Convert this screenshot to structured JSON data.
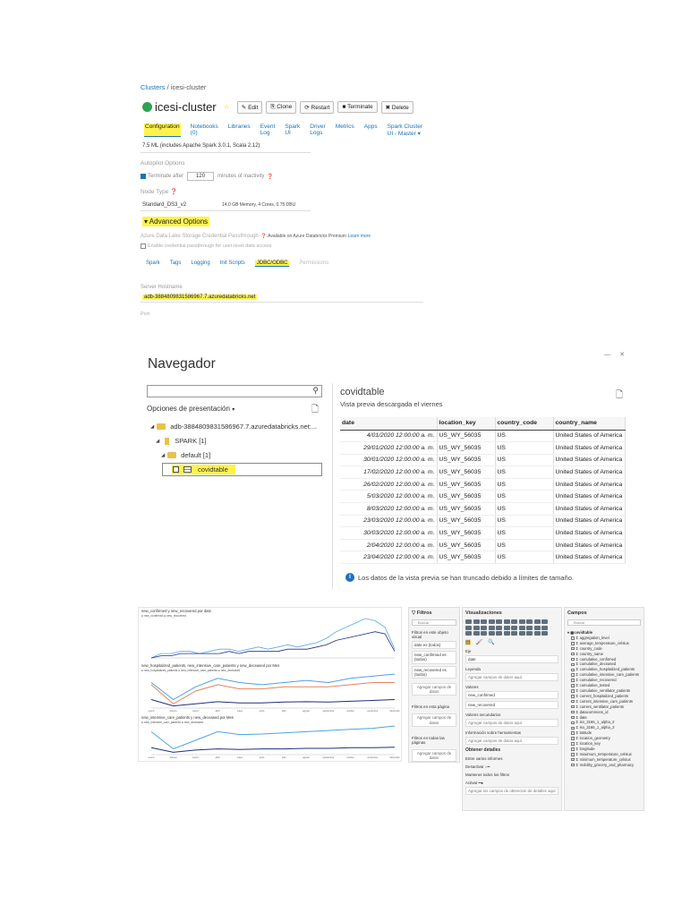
{
  "databricks": {
    "breadcrumb": {
      "clusters": "Clusters",
      "sep": " / ",
      "current": "icesi-cluster"
    },
    "cluster_name": "icesi-cluster",
    "buttons": {
      "edit": "Edit",
      "clone": "Clone",
      "restart": "Restart",
      "terminate": "Terminate",
      "delete": "Delete"
    },
    "tabs": [
      "Configuration",
      "Notebooks (0)",
      "Libraries",
      "Event Log",
      "Spark UI",
      "Driver Logs",
      "Metrics",
      "Apps",
      "Spark Cluster UI - Master ▾"
    ],
    "runtime": "7.5 ML (includes Apache Spark 3.0.1, Scala 2.12)",
    "autopilot_label": "Autopilot Options",
    "terminate_after": "Terminate after",
    "terminate_minutes": "120",
    "inactivity": "minutes of inactivity",
    "node_type_label": "Node Type",
    "node_type": "Standard_DS3_v2",
    "node_spec": "14.0 GB Memory, 4 Cores, 0.75 DBU",
    "advanced_options": "Advanced Options",
    "adls_label": "Azure Data Lake Storage Credential Passthrough",
    "adls_available": "Available on Azure Databricks Premium",
    "learn_more": "Learn more",
    "enable_passthrough": "Enable credential passthrough for user-level data access",
    "subtabs": [
      "Spark",
      "Tags",
      "Logging",
      "Init Scripts",
      "JDBC/ODBC",
      "Permissions"
    ],
    "server_hostname_label": "Server Hostname",
    "server_hostname": "adb-3884809831586967.7.azuredatabricks.net",
    "port_label": "Port"
  },
  "navegador": {
    "title": "Navegador",
    "options_label": "Opciones de presentación",
    "tree": {
      "server": "adb-3884809831586967.7.azuredatabricks.net:...",
      "spark": "SPARK [1]",
      "default": "default [1]",
      "table": "covidtable"
    },
    "preview_title": "covidtable",
    "preview_subtitle": "Vista previa descargada el viernes",
    "columns": [
      "date",
      "location_key",
      "country_code",
      "country_name"
    ],
    "rows": [
      [
        "4/01/2020 12:00:00 a. m.",
        "US_WY_56035",
        "US",
        "United States of America"
      ],
      [
        "29/01/2020 12:00:00 a. m.",
        "US_WY_56035",
        "US",
        "United States of America"
      ],
      [
        "30/01/2020 12:00:00 a. m.",
        "US_WY_56035",
        "US",
        "United States of America"
      ],
      [
        "17/02/2020 12:00:00 a. m.",
        "US_WY_56035",
        "US",
        "United States of America"
      ],
      [
        "26/02/2020 12:00:00 a. m.",
        "US_WY_56035",
        "US",
        "United States of America"
      ],
      [
        "5/03/2020 12:00:00 a. m.",
        "US_WY_56035",
        "US",
        "United States of America"
      ],
      [
        "8/03/2020 12:00:00 a. m.",
        "US_WY_56035",
        "US",
        "United States of America"
      ],
      [
        "23/03/2020 12:00:00 a. m.",
        "US_WY_56035",
        "US",
        "United States of America"
      ],
      [
        "30/03/2020 12:00:00 a. m.",
        "US_WY_56035",
        "US",
        "United States of America"
      ],
      [
        "2/04/2020 12:00:00 a. m.",
        "US_WY_56035",
        "US",
        "United States of America"
      ],
      [
        "23/04/2020 12:00:00 a. m.",
        "US_WY_56035",
        "US",
        "United States of America"
      ]
    ],
    "truncated_notice": "Los datos de la vista previa se han truncado debido a límites de tamaño."
  },
  "report": {
    "chart1_title": "new_confirmed y new_recovered por date",
    "chart1_legend": "● new_confirmed ● new_recovered",
    "chart2_title": "new_hospitalized_patients, new_intensive_care_patients y new_deceased por Mes",
    "chart2_legend": "● new_hospitalized_patients ● new_intensive_care_patients ● new_deceased",
    "chart3_title": "new_intensive_care_patients y new_deceased por Mes",
    "chart3_legend": "● new_intensive_care_patients ● new_deceased",
    "filters": {
      "title": "Filtros",
      "search": "Buscar",
      "visual_label": "Filtros en este objeto visual",
      "cards": [
        "date es (todos)",
        "new_confirmed es (todos)",
        "new_recovered es (todos)"
      ],
      "add": "Agregar campos de datos",
      "page_label": "Filtros en esta página",
      "all_label": "Filtros en todas las páginas"
    },
    "visualizations": {
      "title": "Visualizaciones",
      "eje": "Eje",
      "eje_value": "date",
      "leyenda": "Leyenda",
      "valores": "Valores",
      "valores_items": [
        "new_confirmed",
        "new_recovered"
      ],
      "sec_values": "Valores secundarios",
      "tooltips": "Información sobre herramientas",
      "add": "Agregar campos de datos aquí",
      "drill": "Obtener detalles",
      "cross_report": "Entre varios informes",
      "keep_filters": "Mantener todos los filtros",
      "off": "Desactivar",
      "on": "Activar",
      "drill_add": "Agregar los campos de obtención de detalles aquí"
    },
    "fields": {
      "title": "Campos",
      "search": "Buscar",
      "table": "covidtable",
      "items": [
        "aggregation_level",
        "average_temperature_celsius",
        "country_code",
        "country_name",
        "cumulative_confirmed",
        "cumulative_deceased",
        "cumulative_hospitalized_patients",
        "cumulative_intensive_care_patients",
        "cumulative_recovered",
        "cumulative_tested",
        "cumulative_ventilator_patients",
        "current_hospitalized_patients",
        "current_intensive_care_patients",
        "current_ventilator_patients",
        "datacommons_id",
        "date",
        "iso_3166_1_alpha_2",
        "iso_3166_1_alpha_3",
        "latitude",
        "location_geometry",
        "location_key",
        "longitude",
        "maximum_temperature_celsius",
        "minimum_temperature_celsius",
        "mobility_grocery_and_pharmacy"
      ]
    },
    "chart_data": [
      {
        "type": "line",
        "title": "new_confirmed y new_recovered por date",
        "series": [
          {
            "name": "new_confirmed",
            "values": [
              0,
              2,
              2,
              3,
              3,
              2,
              3,
              4,
              4,
              3,
              4,
              5,
              4,
              5,
              6,
              5,
              6,
              7,
              9,
              12,
              14,
              16,
              18,
              17,
              14,
              4
            ]
          },
          {
            "name": "new_recovered",
            "values": [
              0,
              1,
              1,
              2,
              2,
              2,
              2,
              2,
              3,
              2,
              3,
              3,
              3,
              3,
              4,
              4,
              4,
              5,
              6,
              8,
              9,
              10,
              11,
              12,
              11,
              3
            ]
          }
        ],
        "colors": [
          "#5aa9e6",
          "#1f2f7a"
        ]
      },
      {
        "type": "line",
        "title": "new_hospitalized_patients, new_intensive_care_patients y new_deceased por Mes",
        "categories": [
          "enero",
          "febrero",
          "marzo",
          "abril",
          "mayo",
          "junio",
          "julio",
          "agosto",
          "septiembre",
          "octubre",
          "noviembre",
          "diciembre"
        ],
        "series": [
          {
            "name": "new_hospitalized_patients",
            "values": [
              60,
              20,
              50,
              70,
              60,
              55,
              60,
              65,
              60,
              70,
              75,
              80
            ]
          },
          {
            "name": "new_intensive_care_patients",
            "values": [
              55,
              10,
              40,
              55,
              45,
              45,
              50,
              50,
              50,
              55,
              60,
              60
            ]
          },
          {
            "name": "new_deceased",
            "values": [
              20,
              5,
              10,
              15,
              12,
              12,
              14,
              15,
              14,
              16,
              18,
              20
            ]
          }
        ],
        "colors": [
          "#4ba3e3",
          "#e8825a",
          "#1f2f7a"
        ]
      },
      {
        "type": "line",
        "title": "new_intensive_care_patients y new_deceased por Mes",
        "categories": [
          "enero",
          "febrero",
          "marzo",
          "abril",
          "mayo",
          "junio",
          "julio",
          "agosto",
          "septiembre",
          "octubre",
          "noviembre",
          "diciembre"
        ],
        "series": [
          {
            "name": "new_intensive_care_patients",
            "values": [
              40,
              10,
              25,
              40,
              35,
              36,
              38,
              40,
              42,
              44,
              46,
              50
            ]
          },
          {
            "name": "new_deceased",
            "values": [
              12,
              4,
              8,
              10,
              9,
              10,
              10,
              11,
              11,
              12,
              12,
              13
            ]
          }
        ],
        "colors": [
          "#4ba3e3",
          "#1f2f7a"
        ]
      }
    ]
  }
}
